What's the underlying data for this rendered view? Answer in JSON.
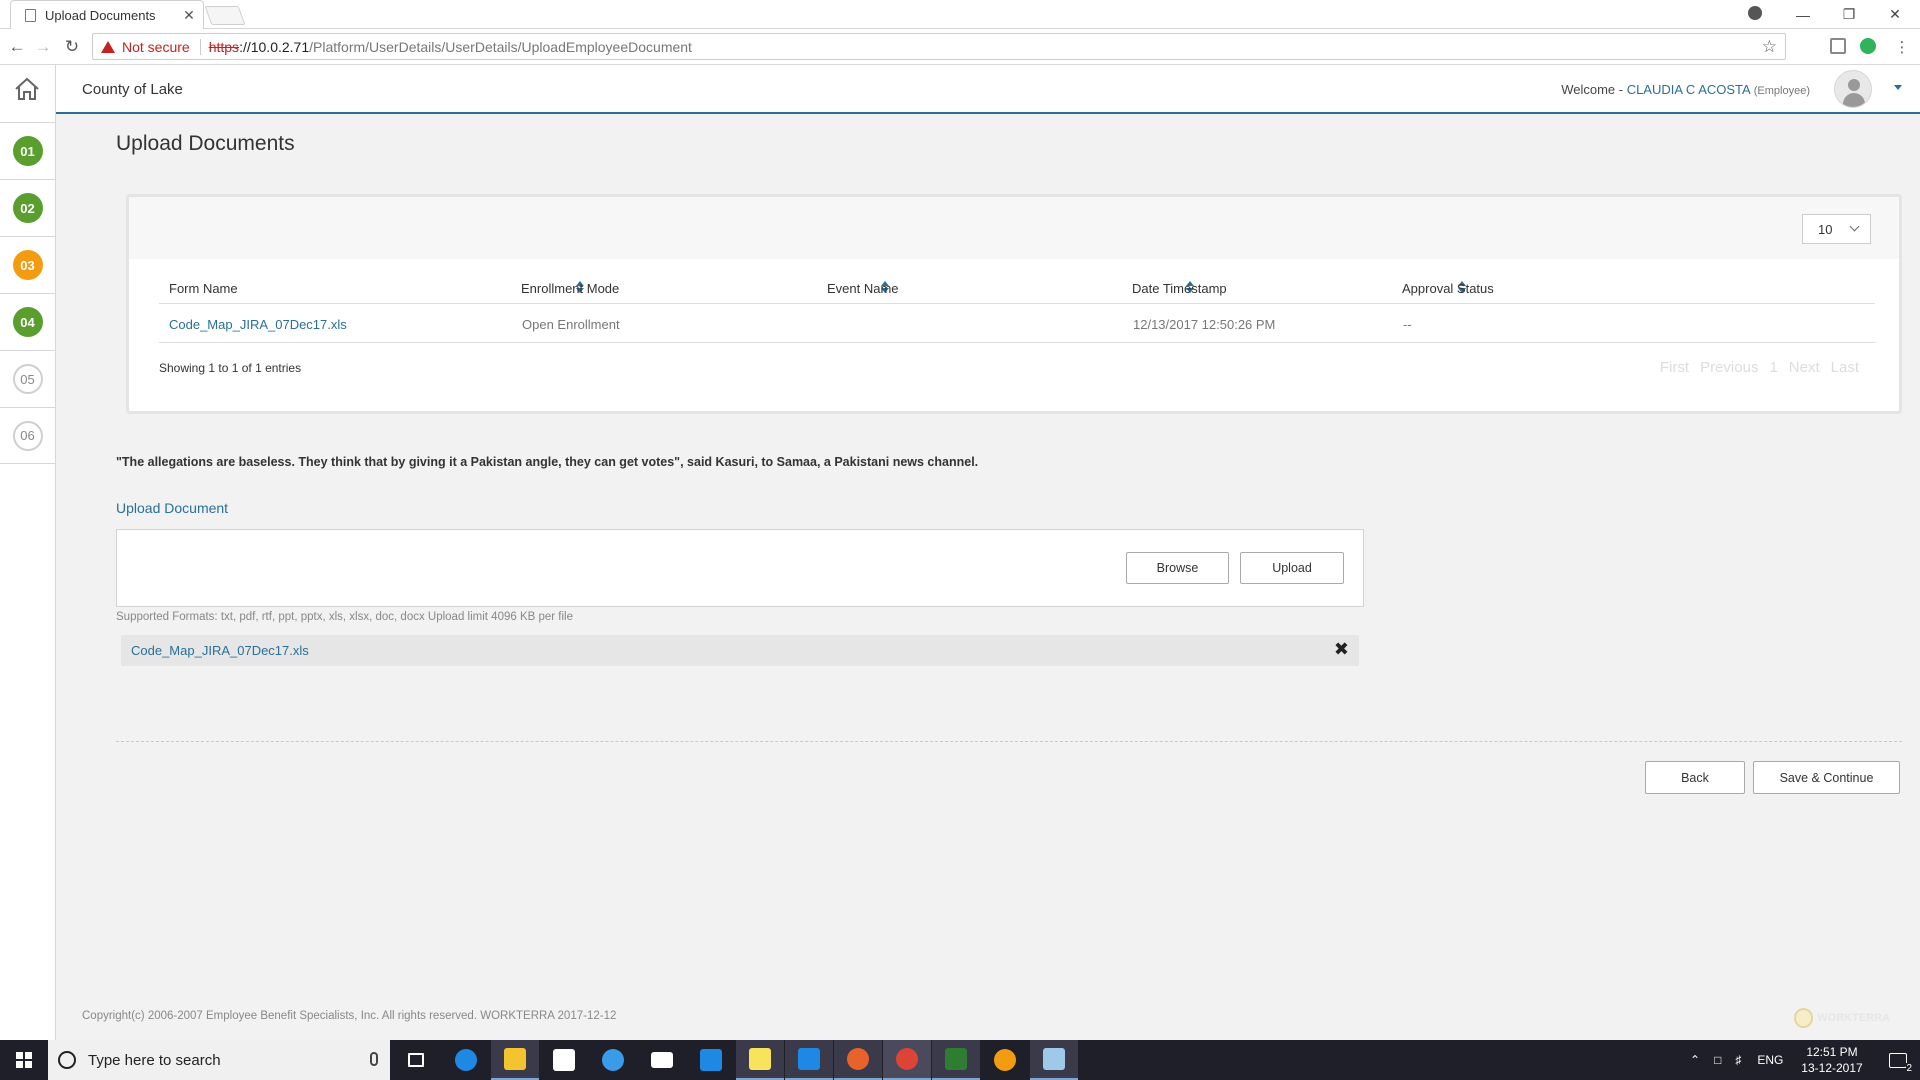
{
  "browser": {
    "tab_title": "Upload Documents",
    "tab_close": "✕",
    "not_secure": "Not secure",
    "url_scheme": "https",
    "url_host": "://10.0.2.71",
    "url_path": "/Platform/UserDetails/UserDetails/UploadEmployeeDocument",
    "win_minimize": "—",
    "win_restore": "❐",
    "win_close": "✕"
  },
  "rail": {
    "steps": [
      {
        "label": "01",
        "state": "complete"
      },
      {
        "label": "02",
        "state": "complete"
      },
      {
        "label": "03",
        "state": "current"
      },
      {
        "label": "04",
        "state": "complete"
      },
      {
        "label": "05",
        "state": "pending"
      },
      {
        "label": "06",
        "state": "pending"
      }
    ]
  },
  "header": {
    "org": "County of Lake",
    "welcome": "Welcome - ",
    "user_name": "CLAUDIA C ACOSTA",
    "user_role": " (Employee)"
  },
  "page": {
    "title": "Upload Documents"
  },
  "grid": {
    "page_size": "10",
    "columns": [
      "Form Name",
      "Enrollment Mode",
      "Event Name",
      "Date Timestamp",
      "Approval Status"
    ],
    "rows": [
      {
        "form_name": "Code_Map_JIRA_07Dec17.xls",
        "enrollment_mode": "Open Enrollment",
        "event_name": "",
        "date_timestamp": "12/13/2017 12:50:26 PM",
        "approval_status": "--"
      }
    ],
    "showing": "Showing 1 to 1 of 1 entries",
    "pager": {
      "first": "First",
      "previous": "Previous",
      "page": "1",
      "next": "Next",
      "last": "Last"
    }
  },
  "quote": "\"The allegations are baseless. They think that by giving it a Pakistan angle, they can get votes\", said Kasuri, to Samaa, a Pakistani news channel.",
  "upload": {
    "label": "Upload Document",
    "browse": "Browse",
    "upload": "Upload",
    "formats": "Supported Formats: txt, pdf, rtf, ppt, pptx, xls, xlsx, doc, docx Upload limit 4096 KB per file",
    "file_name": "Code_Map_JIRA_07Dec17.xls",
    "remove": "✖"
  },
  "actions": {
    "back": "Back",
    "save_continue": "Save & Continue"
  },
  "footer": {
    "copyright": "Copyright(c) 2006-2007 Employee Benefit Specialists, Inc. All rights reserved. WORKTERRA 2017-12-12",
    "powered": "WORKTERRA"
  },
  "taskbar": {
    "search_placeholder": "Type here to search",
    "lang": "ENG",
    "time": "12:51 PM",
    "date": "13-12-2017",
    "notif_count": "2"
  },
  "colors": {
    "accent": "#2a6f97",
    "step_green": "#5a9e2d",
    "step_orange": "#f39c12"
  }
}
